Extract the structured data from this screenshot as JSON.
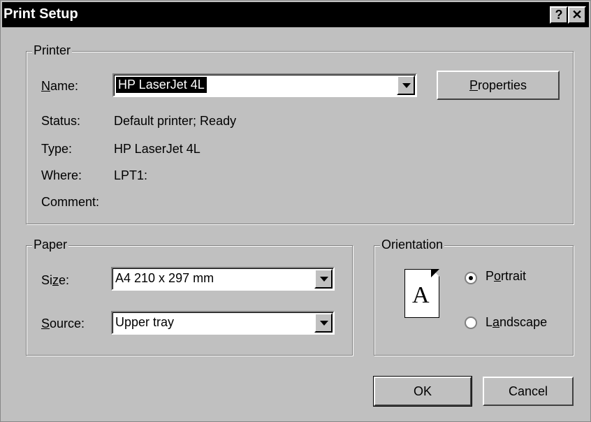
{
  "window": {
    "title": "Print Setup",
    "help_label": "?",
    "close_label": "✕"
  },
  "printer": {
    "legend": "Printer",
    "name_label": "Name:",
    "name_value": "HP LaserJet 4L",
    "properties_label": "Properties",
    "status_label": "Status:",
    "status_value": "Default printer; Ready",
    "type_label": "Type:",
    "type_value": "HP LaserJet 4L",
    "where_label": "Where:",
    "where_value": "LPT1:",
    "comment_label": "Comment:",
    "comment_value": ""
  },
  "paper": {
    "legend": "Paper",
    "size_label": "Size:",
    "size_value": "A4 210 x 297 mm",
    "source_label": "Source:",
    "source_value": "Upper tray"
  },
  "orientation": {
    "legend": "Orientation",
    "icon_letter": "A",
    "portrait_label": "Portrait",
    "landscape_label": "Landscape",
    "selected": "Portrait"
  },
  "buttons": {
    "ok": "OK",
    "cancel": "Cancel"
  }
}
